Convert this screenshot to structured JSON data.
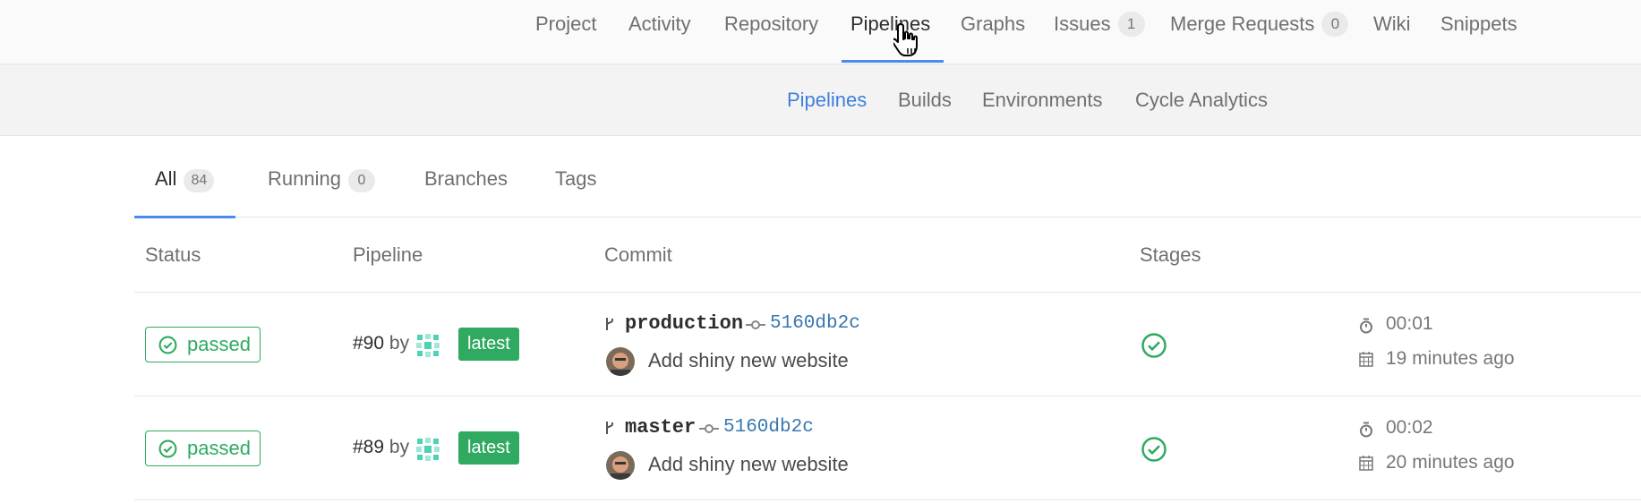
{
  "topnav": {
    "items": [
      {
        "label": "Project"
      },
      {
        "label": "Activity"
      },
      {
        "label": "Repository"
      },
      {
        "label": "Pipelines"
      },
      {
        "label": "Graphs"
      },
      {
        "label": "Issues",
        "count": "1"
      },
      {
        "label": "Merge Requests",
        "count": "0"
      },
      {
        "label": "Wiki"
      },
      {
        "label": "Snippets"
      }
    ],
    "active": "Pipelines"
  },
  "subnav": {
    "items": [
      {
        "label": "Pipelines"
      },
      {
        "label": "Builds"
      },
      {
        "label": "Environments"
      },
      {
        "label": "Cycle Analytics"
      }
    ],
    "active": "Pipelines"
  },
  "tabs": [
    {
      "label": "All",
      "count": "84"
    },
    {
      "label": "Running",
      "count": "0"
    },
    {
      "label": "Branches"
    },
    {
      "label": "Tags"
    }
  ],
  "table": {
    "headers": [
      "Status",
      "Pipeline",
      "Commit",
      "Stages"
    ],
    "rows": [
      {
        "status": "passed",
        "pipeline_id": "#90",
        "by": "by",
        "badge": "latest",
        "branch": "production",
        "sha": "5160db2c",
        "commit_title": "Add shiny new website",
        "duration": "00:01",
        "finished": "19 minutes ago"
      },
      {
        "status": "passed",
        "pipeline_id": "#89",
        "by": "by",
        "badge": "latest",
        "branch": "master",
        "sha": "5160db2c",
        "commit_title": "Add shiny new website",
        "duration": "00:02",
        "finished": "20 minutes ago"
      }
    ]
  },
  "colors": {
    "success": "#2faa60",
    "link": "#3777b0",
    "active_tab": "#4a8bee"
  },
  "icons": {
    "status": "check-circle-icon",
    "branch": "branch-icon",
    "commit": "commit-icon",
    "duration": "stopwatch-icon",
    "finished": "calendar-icon",
    "cursor": "hand-pointer-icon"
  }
}
